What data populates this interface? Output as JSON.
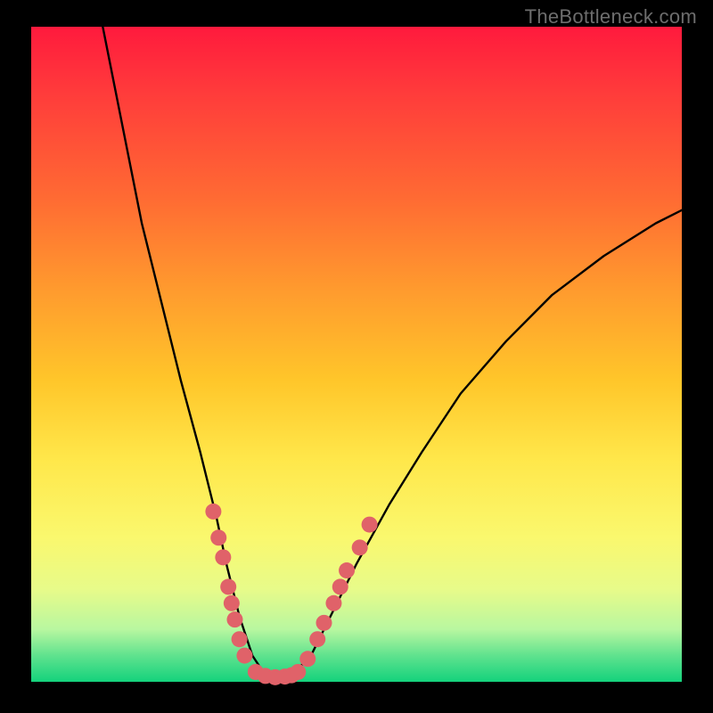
{
  "watermark": "TheBottleneck.com",
  "chart_data": {
    "type": "line",
    "title": "",
    "xlabel": "",
    "ylabel": "",
    "xlim": [
      0,
      100
    ],
    "ylim": [
      0,
      100
    ],
    "curve": {
      "name": "bottleneck-curve",
      "x": [
        11,
        13,
        15,
        17,
        20,
        23,
        26,
        28.5,
        30,
        32,
        34,
        36,
        38,
        40,
        43,
        46,
        50,
        55,
        60,
        66,
        73,
        80,
        88,
        96,
        100
      ],
      "y": [
        100,
        90,
        80,
        70,
        58,
        46,
        35,
        25,
        18,
        10,
        4,
        1,
        0.5,
        1,
        4,
        10,
        18,
        27,
        35,
        44,
        52,
        59,
        65,
        70,
        72
      ]
    },
    "dots": {
      "name": "sample-points",
      "color": "#e06269",
      "radius": 9,
      "points": [
        {
          "x": 28.0,
          "y": 26.0
        },
        {
          "x": 28.8,
          "y": 22.0
        },
        {
          "x": 29.5,
          "y": 19.0
        },
        {
          "x": 30.3,
          "y": 14.5
        },
        {
          "x": 30.8,
          "y": 12.0
        },
        {
          "x": 31.3,
          "y": 9.5
        },
        {
          "x": 32.0,
          "y": 6.5
        },
        {
          "x": 32.8,
          "y": 4.0
        },
        {
          "x": 34.5,
          "y": 1.5
        },
        {
          "x": 36.0,
          "y": 0.9
        },
        {
          "x": 37.5,
          "y": 0.7
        },
        {
          "x": 39.0,
          "y": 0.8
        },
        {
          "x": 40.0,
          "y": 1.0
        },
        {
          "x": 41.0,
          "y": 1.5
        },
        {
          "x": 42.5,
          "y": 3.5
        },
        {
          "x": 44.0,
          "y": 6.5
        },
        {
          "x": 45.0,
          "y": 9.0
        },
        {
          "x": 46.5,
          "y": 12.0
        },
        {
          "x": 47.5,
          "y": 14.5
        },
        {
          "x": 48.5,
          "y": 17.0
        },
        {
          "x": 50.5,
          "y": 20.5
        },
        {
          "x": 52.0,
          "y": 24.0
        }
      ]
    }
  }
}
